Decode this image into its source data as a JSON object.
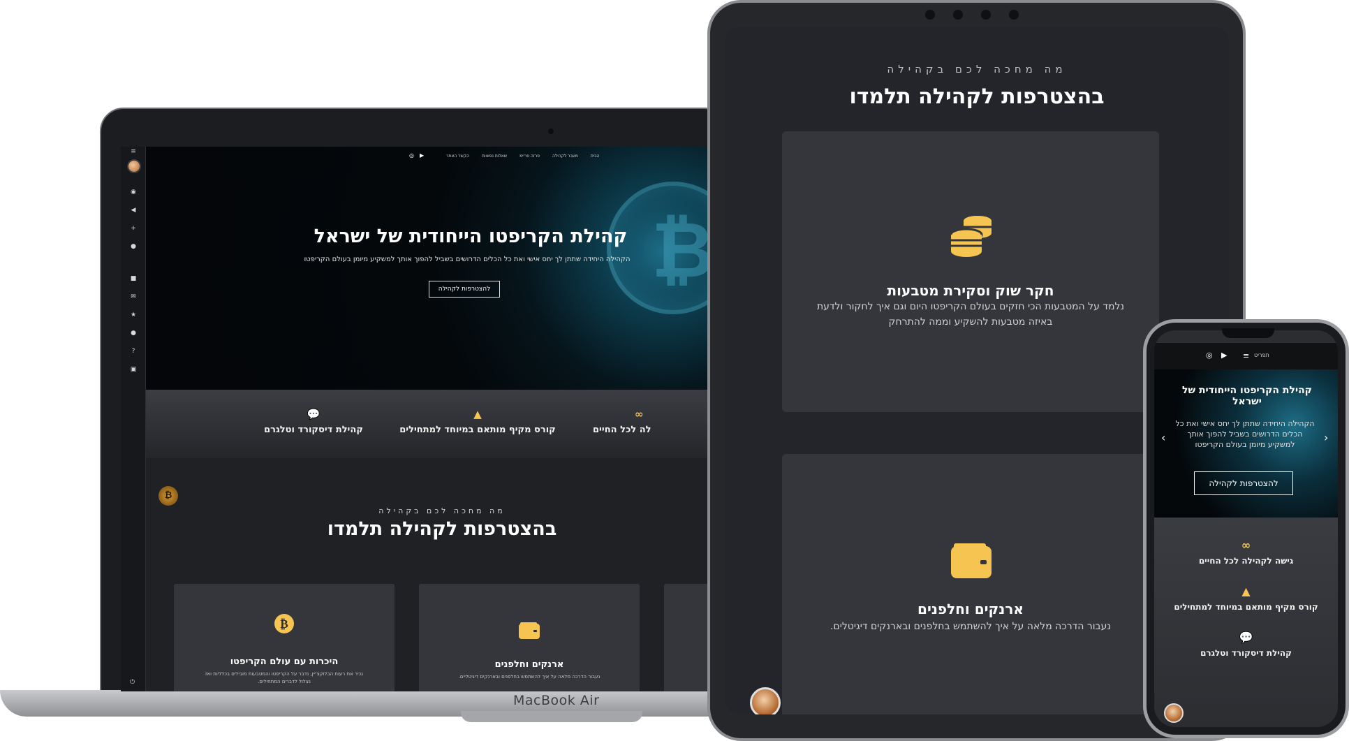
{
  "laptop": {
    "brand": "MacBook Air",
    "nav": [
      "הבית",
      "מעבר לקהילה",
      "פרזה פריימ",
      "שאלות נפוצות",
      "הקשר האתר"
    ],
    "hero": {
      "title": "קהילת הקריפטו הייחודית של ישראל",
      "subtitle": "הקהילה היחידה שתתן לך יחס אישי ואת כל הכלים הדרושים בשביל להפוך אותך למשקיע מיומן בעולם הקריפטו",
      "button": "להצטרפות לקהילה"
    },
    "features": [
      "קהילת דיסקורד וטלגרם",
      "קורס מקיף מותאם במיוחד למתחילים",
      "לה לכל החיים"
    ],
    "section": {
      "kicker": "מה מחכה לכם בקהילה",
      "heading": "בהצטרפות לקהילה תלמדו"
    },
    "cards": [
      {
        "title": "היכרות עם עולם הקריפטו",
        "desc": "נכיר את רעות הבלוקצ'יין, נדבר על הקריפטו והמטבעות מובילים בכלליות ואז נצלול לדברים המתחילים."
      },
      {
        "title": "ארנקים וחלפנים",
        "desc": "נעבור הדרכה מלאה על איך להשתמש בחלפנים ובארנקים דיגיטליים."
      }
    ]
  },
  "tablet": {
    "kicker": "מה מחכה לכם בקהילה",
    "heading": "בהצטרפות לקהילה תלמדו",
    "cards": [
      {
        "title": "חקר שוק וסקירת מטבעות",
        "desc": "נלמד על המטבעות הכי חזקים בעולם הקריפטו היום וגם איך לחקור ולדעת באיזה מטבעות להשקיע וממה להתרחק"
      },
      {
        "title": "ארנקים וחלפנים",
        "desc": "נעבור הדרכה מלאה על איך להשתמש בחלפנים ובארנקים דיגיטלים."
      }
    ]
  },
  "phone": {
    "nav_label": "תפריט",
    "hero": {
      "title": "קהילת הקריפטו הייחודית של ישראל",
      "subtitle": "הקהילה היחידה שתתן לך יחס אישי ואת כל הכלים הדרושים בשביל להפוך אותך למשקיע מיומן בעולם הקריפטו",
      "button": "להצטרפות לקהילה"
    },
    "features": [
      "גישה לקהילה לכל החיים",
      "קורס מקיף מותאם במיוחד למתחילים",
      "קהילת דיסקורד וטלגרם"
    ]
  },
  "colors": {
    "accent": "#f5c451",
    "background": "#23252a",
    "card": "#34363c"
  }
}
